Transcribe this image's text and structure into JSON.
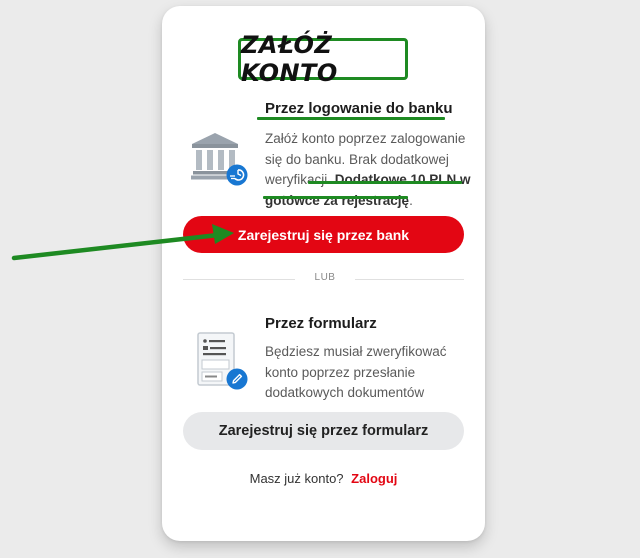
{
  "header": {
    "title": "ZAŁÓŻ KONTO"
  },
  "bank_option": {
    "heading": "Przez logowanie do banku",
    "desc_plain": "Załóż konto poprzez zalogowanie się do banku. Brak dodatkowej weryfikacji.",
    "desc_line1": "Załóż konto poprzez zalogowanie",
    "desc_line2": "się do banku. Brak dodatkowej",
    "desc_line3": "weryfikacji.",
    "bonus_part1": "Dodatkowe 10 PLN w",
    "bonus_part2": "gotówce za rejestrację",
    "bonus_end": ".",
    "button_label": "Zarejestruj się przez bank"
  },
  "divider": {
    "label": "LUB"
  },
  "form_option": {
    "heading": "Przez formularz",
    "desc_line1": "Będziesz musiał zweryfikować",
    "desc_line2": "konto poprzez przesłanie",
    "desc_line3": "dodatkowych dokumentów",
    "button_label": "Zarejestruj się przez formularz"
  },
  "footer": {
    "question": "Masz już konto?",
    "login_link": "Zaloguj"
  },
  "colors": {
    "brand_red": "#e30613",
    "annotation_green": "#1e8a22",
    "badge_blue": "#1877d2"
  },
  "icons": {
    "bank": "bank-icon",
    "bank_badge": "fast-transfer-icon",
    "form": "document-form-icon",
    "form_badge": "pencil-icon"
  }
}
